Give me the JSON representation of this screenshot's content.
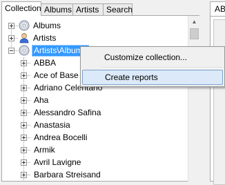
{
  "tabs": [
    "Collection",
    "Albums",
    "Artists",
    "Search"
  ],
  "right_tab_label": "ABI",
  "tree": {
    "top_nodes": [
      {
        "label": "Albums",
        "icon": "cd-icon",
        "expander": "plus"
      },
      {
        "label": "Artists",
        "icon": "artist-person-icon",
        "expander": "plus"
      },
      {
        "label": "Artists\\Albums",
        "icon": "cd-icon",
        "expander": "minus",
        "selected": true
      }
    ],
    "children": [
      "ABBA",
      "Ace of Base",
      "Adriano Celentano",
      "Aha",
      "Alessandro Safina",
      "Anastasia",
      "Andrea Bocelli",
      "Armik",
      "Avril Lavigne",
      "Barbara Streisand"
    ]
  },
  "context_menu": {
    "items": [
      {
        "label": "Customize collection..."
      },
      {
        "label": "Create reports",
        "hovered": true
      }
    ]
  },
  "colors": {
    "selection": "#3399ff",
    "menu_hover": "#dbe9f8",
    "menu_hover_border": "#7da2ce"
  }
}
